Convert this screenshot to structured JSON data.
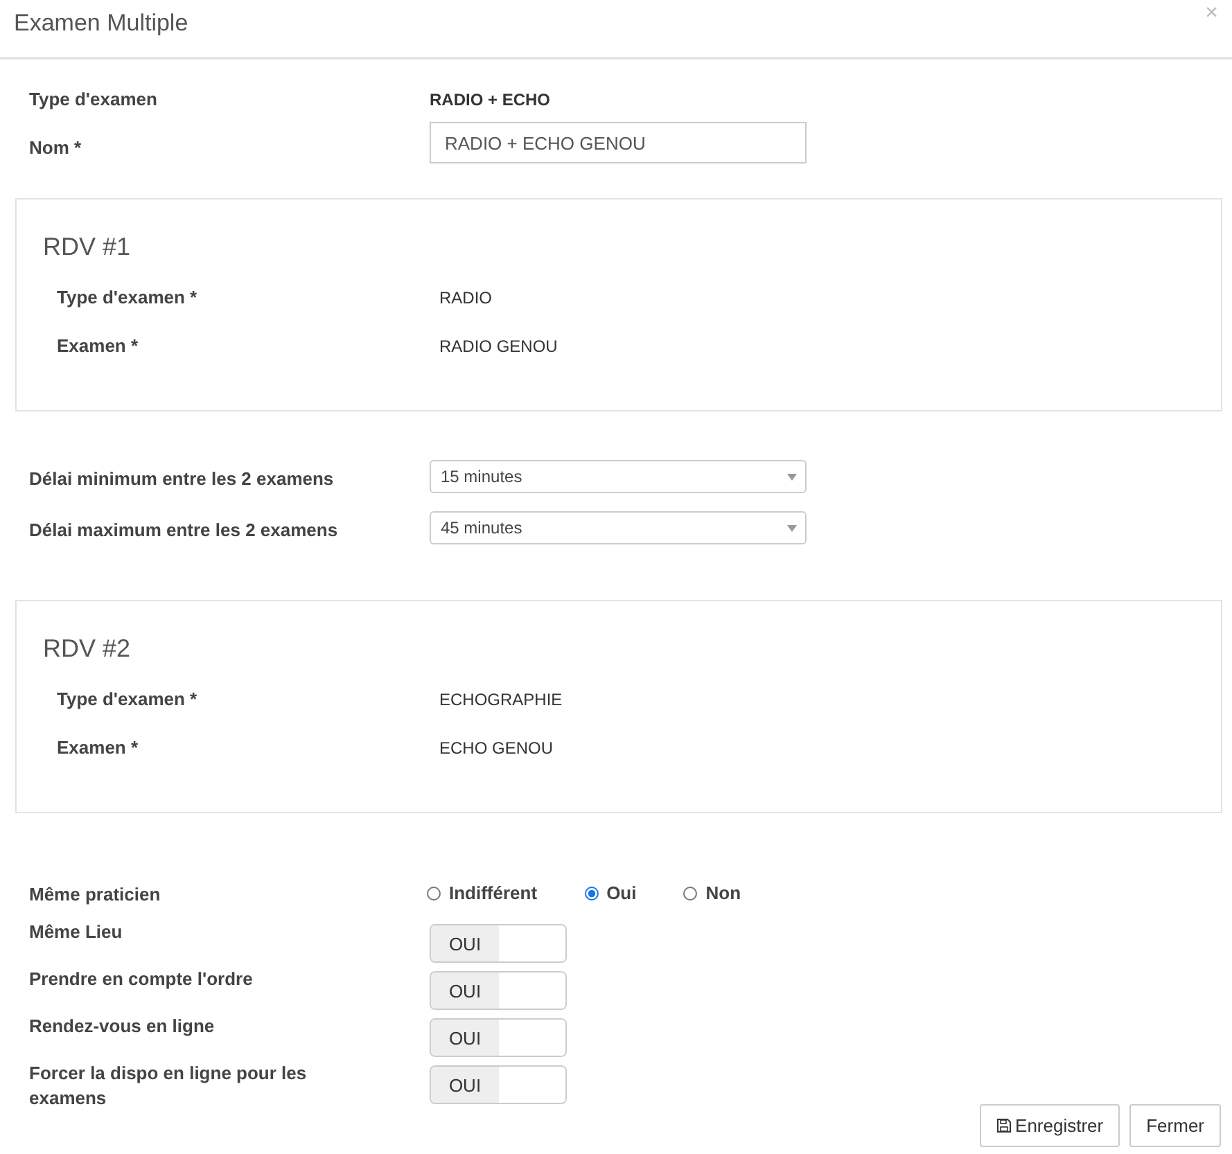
{
  "window": {
    "title": "Examen Multiple",
    "close": "×"
  },
  "fields": [
    {
      "kind": "text",
      "label": "Type d'examen",
      "value": "RADIO + ECHO"
    },
    {
      "kind": "input",
      "label": "Nom *",
      "value": "RADIO + ECHO GENOU"
    }
  ],
  "appointments": [
    {
      "title": "RDV #1",
      "rows": [
        {
          "label": "Type d'examen *",
          "value": "RADIO"
        },
        {
          "label": "Examen *",
          "value": "RADIO GENOU"
        }
      ]
    },
    {
      "title": "RDV #2",
      "rows": [
        {
          "label": "Type d'examen *",
          "value": "ECHOGRAPHIE"
        },
        {
          "label": "Examen *",
          "value": "ECHO GENOU"
        }
      ]
    }
  ],
  "delays": [
    {
      "label": "Délai minimum entre les 2 examens",
      "value": "15 minutes"
    },
    {
      "label": "Délai maximum entre les 2 examens",
      "value": "45 minutes"
    }
  ],
  "same_practitioner": {
    "label": "Même praticien",
    "options": [
      {
        "label": "Indifférent",
        "selected": false
      },
      {
        "label": "Oui",
        "selected": true
      },
      {
        "label": "Non",
        "selected": false
      }
    ]
  },
  "switches": [
    {
      "label": "Même Lieu",
      "text": "OUI",
      "on": true
    },
    {
      "label": "Prendre en compte l'ordre",
      "text": "OUI",
      "on": true
    },
    {
      "label": "Rendez-vous en ligne",
      "text": "OUI",
      "on": true
    },
    {
      "label": "Forcer la dispo en ligne pour les examens",
      "text": "OUI",
      "on": true
    }
  ],
  "buttons": [
    {
      "kind": "save",
      "label": "Enregistrer"
    },
    {
      "kind": "close",
      "label": "Fermer"
    }
  ]
}
